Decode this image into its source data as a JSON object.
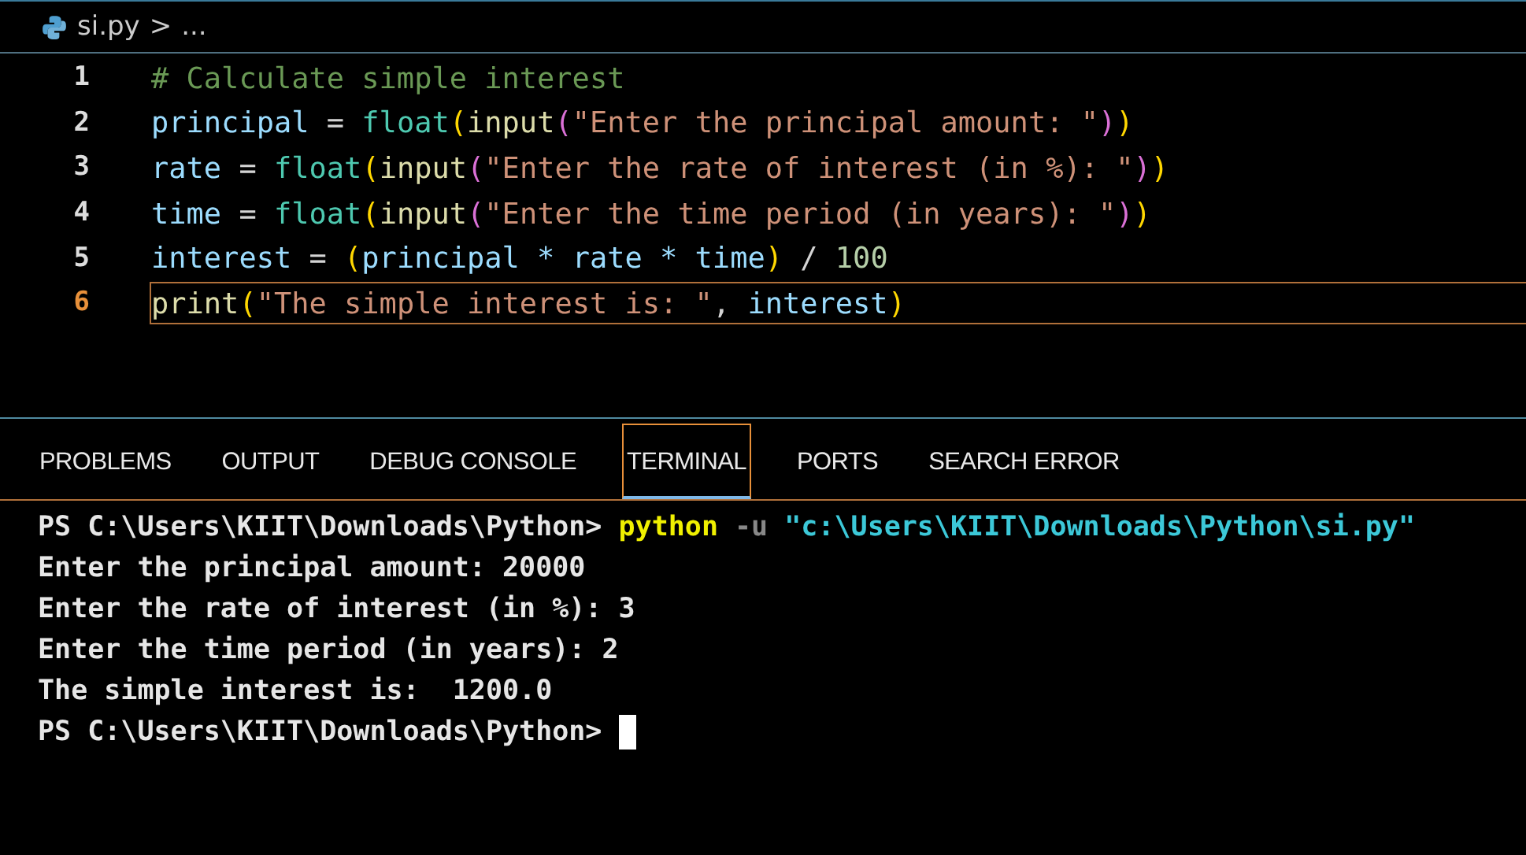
{
  "breadcrumb": {
    "file": "si.py",
    "separator": ">",
    "rest": "..."
  },
  "editor": {
    "lines": [
      {
        "number": "1",
        "current": false,
        "tokens": [
          {
            "text": "# Calculate simple interest",
            "kind": "comment"
          }
        ]
      },
      {
        "number": "2",
        "current": false,
        "tokens": [
          {
            "text": "principal",
            "kind": "variable"
          },
          {
            "text": " = ",
            "kind": "plain"
          },
          {
            "text": "float",
            "kind": "function"
          },
          {
            "text": "(",
            "kind": "paren1"
          },
          {
            "text": "input",
            "kind": "function2"
          },
          {
            "text": "(",
            "kind": "paren2"
          },
          {
            "text": "\"Enter the principal amount: \"",
            "kind": "string"
          },
          {
            "text": ")",
            "kind": "paren2"
          },
          {
            "text": ")",
            "kind": "paren1"
          }
        ]
      },
      {
        "number": "3",
        "current": false,
        "tokens": [
          {
            "text": "rate",
            "kind": "variable"
          },
          {
            "text": " = ",
            "kind": "plain"
          },
          {
            "text": "float",
            "kind": "function"
          },
          {
            "text": "(",
            "kind": "paren1"
          },
          {
            "text": "input",
            "kind": "function2"
          },
          {
            "text": "(",
            "kind": "paren2"
          },
          {
            "text": "\"Enter the rate of interest (in %): \"",
            "kind": "string"
          },
          {
            "text": ")",
            "kind": "paren2"
          },
          {
            "text": ")",
            "kind": "paren1"
          }
        ]
      },
      {
        "number": "4",
        "current": false,
        "tokens": [
          {
            "text": "time",
            "kind": "variable"
          },
          {
            "text": " = ",
            "kind": "plain"
          },
          {
            "text": "float",
            "kind": "function"
          },
          {
            "text": "(",
            "kind": "paren1"
          },
          {
            "text": "input",
            "kind": "function2"
          },
          {
            "text": "(",
            "kind": "paren2"
          },
          {
            "text": "\"Enter the time period (in years): \"",
            "kind": "string"
          },
          {
            "text": ")",
            "kind": "paren2"
          },
          {
            "text": ")",
            "kind": "paren1"
          }
        ]
      },
      {
        "number": "5",
        "current": false,
        "tokens": [
          {
            "text": "interest",
            "kind": "variable"
          },
          {
            "text": " = ",
            "kind": "plain"
          },
          {
            "text": "(",
            "kind": "paren1"
          },
          {
            "text": "principal * rate * time",
            "kind": "variable"
          },
          {
            "text": ")",
            "kind": "paren1"
          },
          {
            "text": " / ",
            "kind": "plain"
          },
          {
            "text": "100",
            "kind": "number"
          }
        ]
      },
      {
        "number": "6",
        "current": true,
        "tokens": [
          {
            "text": "print",
            "kind": "function2"
          },
          {
            "text": "(",
            "kind": "paren1"
          },
          {
            "text": "\"The simple interest is: \"",
            "kind": "string"
          },
          {
            "text": ", ",
            "kind": "plain"
          },
          {
            "text": "interest",
            "kind": "variable"
          },
          {
            "text": ")",
            "kind": "paren1"
          }
        ]
      }
    ]
  },
  "panel": {
    "tabs": [
      {
        "label": "PROBLEMS",
        "selected": false
      },
      {
        "label": "OUTPUT",
        "selected": false
      },
      {
        "label": "DEBUG CONSOLE",
        "selected": false
      },
      {
        "label": "TERMINAL",
        "selected": true
      },
      {
        "label": "PORTS",
        "selected": false
      },
      {
        "label": "SEARCH ERROR",
        "selected": false
      }
    ],
    "terminal": {
      "lines": [
        [
          {
            "text": "PS C:\\Users\\KIIT\\Downloads\\Python> ",
            "kind": "output"
          },
          {
            "text": "python",
            "kind": "command"
          },
          {
            "text": " -u ",
            "kind": "flag"
          },
          {
            "text": "\"c:\\Users\\KIIT\\Downloads\\Python\\si.py\"",
            "kind": "path"
          }
        ],
        [
          {
            "text": "Enter the principal amount: 20000",
            "kind": "output"
          }
        ],
        [
          {
            "text": "Enter the rate of interest (in %): 3",
            "kind": "output"
          }
        ],
        [
          {
            "text": "Enter the time period (in years): 2",
            "kind": "output"
          }
        ],
        [
          {
            "text": "The simple interest is:  1200.0",
            "kind": "output"
          }
        ],
        [
          {
            "text": "PS C:\\Users\\KIIT\\Downloads\\Python> ",
            "kind": "output"
          }
        ]
      ],
      "cursor": true
    }
  }
}
